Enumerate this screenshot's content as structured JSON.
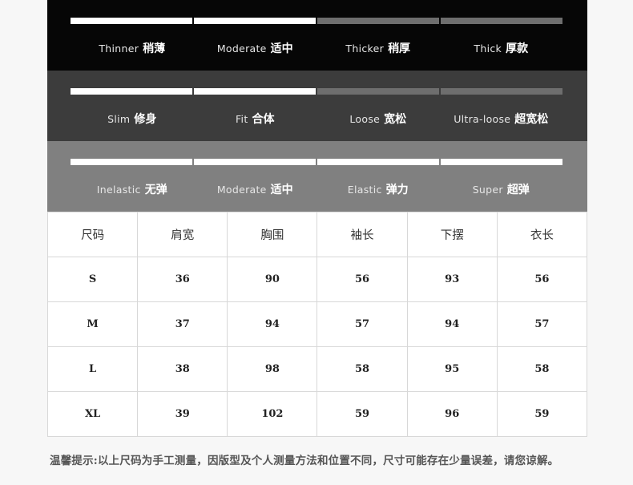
{
  "thickness": {
    "level": 2,
    "options": [
      {
        "en": "Thinner",
        "cn": "稍薄"
      },
      {
        "en": "Moderate",
        "cn": "适中"
      },
      {
        "en": "Thicker",
        "cn": "稍厚"
      },
      {
        "en": "Thick",
        "cn": "厚款"
      }
    ]
  },
  "fit": {
    "level": 2,
    "options": [
      {
        "en": "Slim",
        "cn": "修身"
      },
      {
        "en": "Fit",
        "cn": "合体"
      },
      {
        "en": "Loose",
        "cn": "宽松"
      },
      {
        "en": "Ultra-loose",
        "cn": "超宽松"
      }
    ]
  },
  "elasticity": {
    "level": 4,
    "options": [
      {
        "en": "Inelastic",
        "cn": "无弹"
      },
      {
        "en": "Moderate",
        "cn": "适中"
      },
      {
        "en": "Elastic",
        "cn": "弹力"
      },
      {
        "en": "Super",
        "cn": "超弹"
      }
    ]
  },
  "size_table": {
    "headers": [
      "尺码",
      "肩宽",
      "胸围",
      "袖长",
      "下摆",
      "衣长"
    ],
    "rows": [
      [
        "S",
        "36",
        "90",
        "56",
        "93",
        "56"
      ],
      [
        "M",
        "37",
        "94",
        "57",
        "94",
        "57"
      ],
      [
        "L",
        "38",
        "98",
        "58",
        "95",
        "58"
      ],
      [
        "XL",
        "39",
        "102",
        "59",
        "96",
        "59"
      ]
    ]
  },
  "note": "温馨提示:以上尺码为手工测量，因版型及个人测量方法和位置不同，尺寸可能存在少量误差，请您谅解。",
  "colors": {
    "band_thickness": "#060606",
    "band_fit": "#3c3c3c",
    "band_elasticity": "#808080"
  }
}
